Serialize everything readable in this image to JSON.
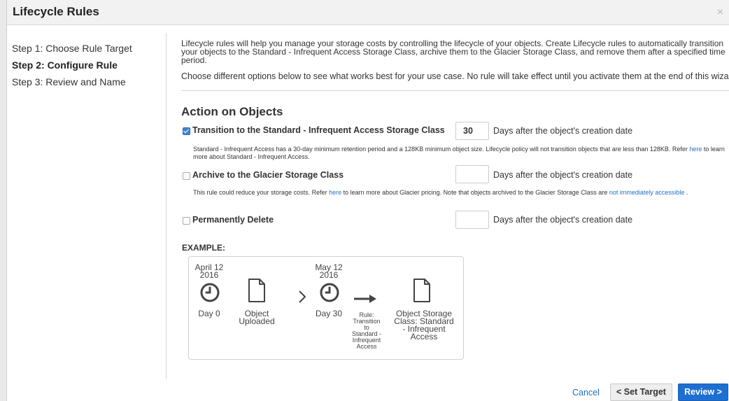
{
  "dialog": {
    "title": "Lifecycle Rules",
    "close_glyph": "×"
  },
  "steps": [
    {
      "label": "Step 1: Choose Rule Target",
      "active": false
    },
    {
      "label": "Step 2: Configure Rule",
      "active": true
    },
    {
      "label": "Step 3: Review and Name",
      "active": false
    }
  ],
  "intro": {
    "p1": "Lifecycle rules will help you manage your storage costs by controlling the lifecycle of your objects. Create Lifecycle rules to automatically transition your objects to the Standard - Infrequent Access Storage Class, archive them to the Glacier Storage Class, and remove them after a specified time period.",
    "p2": "Choose different options below to see what works best for your use case. No rule will take effect until you activate them at the end of this wizard."
  },
  "section_title": "Action on Objects",
  "options": {
    "transition": {
      "label": "Transition to the Standard - Infrequent Access Storage Class",
      "checked": true,
      "days_value": "30",
      "days_text": "Days after the object's creation date",
      "note_prefix": "Standard - Infrequent Access has a 30-day minimum retention period and a 128KB minimum object size. Lifecycle policy will not transition objects that are less than 128KB. Refer ",
      "note_link": "here",
      "note_suffix": " to learn more about Standard - Infrequent Access."
    },
    "archive": {
      "label": "Archive to the Glacier Storage Class",
      "checked": false,
      "days_value": "",
      "days_text": "Days after the object's creation date",
      "note_prefix": "This rule could reduce your storage costs. Refer ",
      "note_link": "here",
      "note_mid": " to learn more about Glacier pricing. Note that objects archived to the Glacier Storage Class are ",
      "note_link2": "not immediately accessible",
      "note_suffix": " ."
    },
    "delete": {
      "label": "Permanently Delete",
      "checked": false,
      "days_value": "",
      "days_text": "Days after the object's creation date"
    }
  },
  "example": {
    "label": "EXAMPLE:",
    "date1_line1": "April 12",
    "date1_line2": "2016",
    "day0": "Day 0",
    "uploaded_line1": "Object",
    "uploaded_line2": "Uploaded",
    "date2_line1": "May 12",
    "date2_line2": "2016",
    "day30": "Day 30",
    "rule_lines": [
      "Rule:",
      "Transition",
      "to",
      "Standard -",
      "Infrequent",
      "Access"
    ],
    "storage_lines": [
      "Object Storage",
      "Class: Standard",
      "- Infrequent",
      "Access"
    ]
  },
  "footer": {
    "cancel": "Cancel",
    "back": "< Set Target",
    "next": "Review >"
  },
  "colors": {
    "accent": "#1e6fd1",
    "link": "#1f6fc9",
    "icon": "#444444"
  }
}
